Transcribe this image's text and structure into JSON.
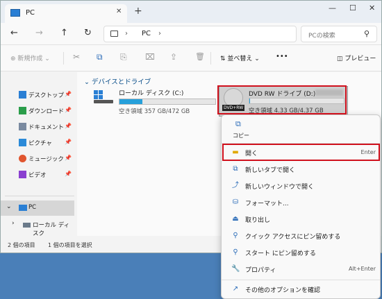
{
  "window": {
    "tab_title": "PC",
    "close": "✕",
    "newtab": "+",
    "minimize": "—",
    "maximize": "☐",
    "close_window": "✕"
  },
  "nav": {
    "back": "←",
    "forward": "→",
    "up": "↑",
    "refresh": "↻",
    "chev1": "›",
    "location": "PC",
    "chev2": "›",
    "search_placeholder": "PCの検索",
    "search_icon": "⚲"
  },
  "toolbar": {
    "new_label": "⊕ 新規作成 ⌄",
    "cut": "✂",
    "copy": "⧉",
    "paste": "⎘",
    "rename": "⌧",
    "share": "⇪",
    "delete": "🗑",
    "sort_label": "⇅ 並べ替え ⌄",
    "more": "•••",
    "preview_label": "◫ プレビュー"
  },
  "sidebar": {
    "items": [
      {
        "label": "デスクトップ",
        "pin": "📌",
        "color": "#2a7fd4"
      },
      {
        "label": "ダウンロード",
        "pin": "📌",
        "color": "#2a9d4a"
      },
      {
        "label": "ドキュメント",
        "pin": "📌",
        "color": "#7a8aa0"
      },
      {
        "label": "ピクチャ",
        "pin": "📌",
        "color": "#2b8ad8"
      },
      {
        "label": "ミュージック",
        "pin": "📌",
        "color": "#e0552e"
      },
      {
        "label": "ビデオ",
        "pin": "📌",
        "color": "#8a3fd0"
      }
    ],
    "pc_label": "PC",
    "pc_expand": "⌄",
    "local_label": "ローカル ディスク",
    "local_expand": "›"
  },
  "status": {
    "count": "2 個の項目",
    "selected": "1 個の項目を選択"
  },
  "main": {
    "group_header": "⌄ デバイスとドライブ",
    "drives": [
      {
        "name": "ローカル ディスク (C:)",
        "free": "空き領域 357 GB/472 GB",
        "used_fraction": 0.24
      },
      {
        "name": "DVD RW ドライブ (D:)",
        "free": "空き領域 4.33 GB/4.37 GB",
        "used_fraction": 0.01,
        "badge": "DVD+RW"
      }
    ]
  },
  "menu": {
    "copy_label": "コピー",
    "copy_icon": "⧉",
    "items": [
      {
        "label": "開く",
        "shortcut": "Enter",
        "icon": "folder-icon",
        "glyph": "▬"
      },
      {
        "label": "新しいタブで開く",
        "shortcut": "",
        "icon": "new-tab-icon",
        "glyph": "⧉"
      },
      {
        "label": "新しいウィンドウで開く",
        "shortcut": "",
        "icon": "new-window-icon",
        "glyph": "⤴"
      },
      {
        "label": "フォーマット...",
        "shortcut": "",
        "icon": "format-icon",
        "glyph": "⛁"
      },
      {
        "label": "取り出し",
        "shortcut": "",
        "icon": "eject-icon",
        "glyph": "⏏"
      },
      {
        "label": "クイック アクセスにピン留めする",
        "shortcut": "",
        "icon": "pin-icon",
        "glyph": "⚲"
      },
      {
        "label": "スタート にピン留めする",
        "shortcut": "",
        "icon": "pin-start-icon",
        "glyph": "⚲"
      },
      {
        "label": "プロパティ",
        "shortcut": "Alt+Enter",
        "icon": "properties-icon",
        "glyph": "🔧"
      },
      {
        "label": "その他のオプションを確認",
        "shortcut": "",
        "icon": "more-options-icon",
        "glyph": "↗"
      }
    ]
  },
  "colors": {
    "highlight": "#d0101c",
    "accent": "#26a0da"
  }
}
